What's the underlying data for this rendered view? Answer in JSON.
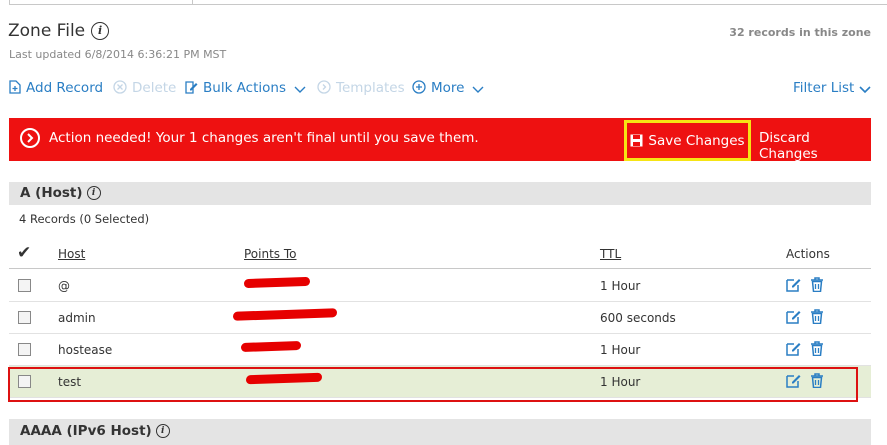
{
  "header": {
    "title": "Zone File",
    "updated": "Last updated 6/8/2014 6:36:21 PM MST",
    "count": "32 records in this zone"
  },
  "toolbar": {
    "add": "Add Record",
    "delete": "Delete",
    "bulk": "Bulk Actions",
    "templates": "Templates",
    "more": "More",
    "filter": "Filter List"
  },
  "alert": {
    "message": "Action needed! Your 1 changes aren't final until you save them.",
    "save": "Save Changes",
    "discard": "Discard Changes",
    "color": "#ee1111"
  },
  "section_a": {
    "title": "A (Host)",
    "records": "4 Records (0 Selected)",
    "columns": {
      "host": "Host",
      "points": "Points To",
      "ttl": "TTL",
      "actions": "Actions"
    },
    "rows": [
      {
        "host": "@",
        "ttl": "1 Hour"
      },
      {
        "host": "admin",
        "ttl": "600 seconds"
      },
      {
        "host": "hostease",
        "ttl": "1 Hour"
      },
      {
        "host": "test",
        "ttl": "1 Hour"
      }
    ]
  },
  "section_aaaa": {
    "title": "AAAA (IPv6 Host)"
  },
  "icons": {
    "edit": "edit-icon",
    "delete": "trash-icon",
    "accent": "#2a7ec4"
  }
}
